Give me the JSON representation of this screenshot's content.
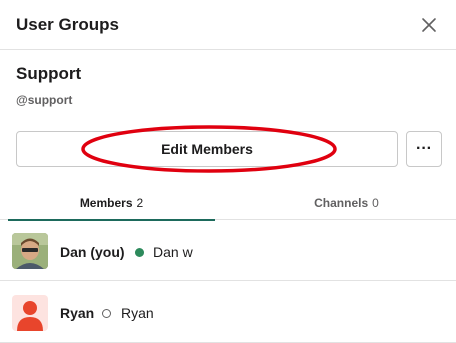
{
  "header": {
    "title": "User Groups",
    "close_icon": "close-icon"
  },
  "group": {
    "name": "Support",
    "handle": "@support"
  },
  "actions": {
    "edit_label": "Edit Members",
    "more_label": "···"
  },
  "tabs": [
    {
      "label": "Members",
      "count": "2",
      "active": true
    },
    {
      "label": "Channels",
      "count": "0",
      "active": false
    }
  ],
  "members": [
    {
      "name": "Dan (you)",
      "display_name": "Dan w",
      "status": "active"
    },
    {
      "name": "Ryan",
      "display_name": "Ryan",
      "status": "away"
    }
  ],
  "colors": {
    "active_tab_underline": "#1d6a5c",
    "status_active": "#2d8a5c",
    "annotation": "#e0000f",
    "avatar_placeholder_bg": "#fde3e0",
    "avatar_placeholder_fg": "#e8452c"
  }
}
